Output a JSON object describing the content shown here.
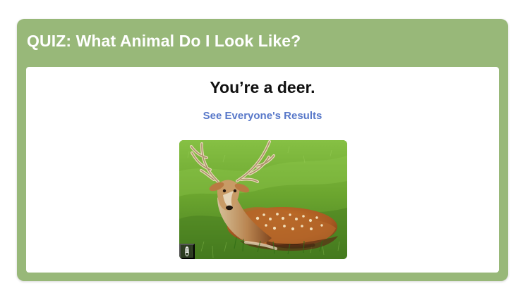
{
  "quiz": {
    "title": "QUIZ: What Animal Do I Look Like?",
    "result_heading": "You’re a deer.",
    "results_link_label": "See Everyone's Results",
    "image": {
      "alt": "deer",
      "info_icon": "info-icon",
      "info_glyph": "i"
    }
  },
  "colors": {
    "card_background": "#98b879",
    "link": "#5878c9",
    "heading": "#111111"
  }
}
